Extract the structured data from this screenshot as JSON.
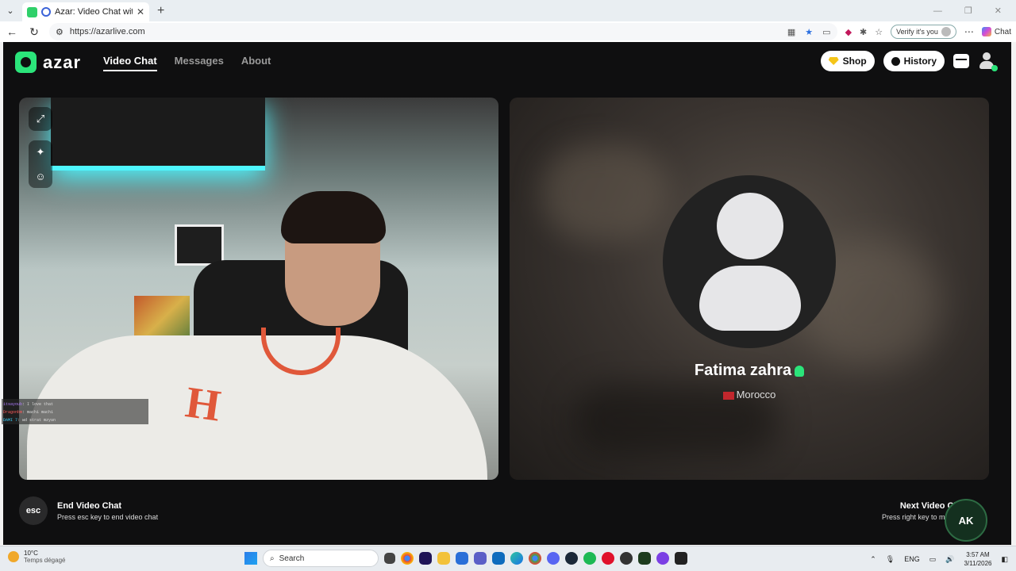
{
  "browser": {
    "tab_title": "Azar: Video Chat with New Pe",
    "url": "https://azarlive.com",
    "verify_label": "Verify it's you",
    "chat_label": "Chat"
  },
  "app": {
    "logo_text": "azar",
    "nav": [
      {
        "label": "Video Chat",
        "active": true
      },
      {
        "label": "Messages",
        "active": false
      },
      {
        "label": "About",
        "active": false
      }
    ],
    "shop_label": "Shop",
    "history_label": "History"
  },
  "peer": {
    "name": "Fatima zahra",
    "country": "Morocco"
  },
  "overlay_chat": [
    {
      "user": "itsayoub",
      "msg": ": I love that"
    },
    {
      "user": "Dragonbm",
      "msg": ": machi machi"
    },
    {
      "user": "DAMI 7",
      "msg": ": wd strat mzyan"
    }
  ],
  "bottom": {
    "esc_label": "esc",
    "end_title": "End Video Chat",
    "end_sub": "Press esc key to end video chat",
    "next_title": "Next Video Chat",
    "next_sub": "Press right key to meet oth",
    "badge_text": "AK"
  },
  "taskbar": {
    "temp": "10°C",
    "weather_desc": "Temps dégagé",
    "search_placeholder": "Search",
    "lang": "ENG",
    "time": "3:57 AM",
    "date": "3/11/2026"
  },
  "colors": {
    "brand": "#2be47a",
    "app_bg": "#0f0f10",
    "accent_orange": "#e0583a"
  }
}
